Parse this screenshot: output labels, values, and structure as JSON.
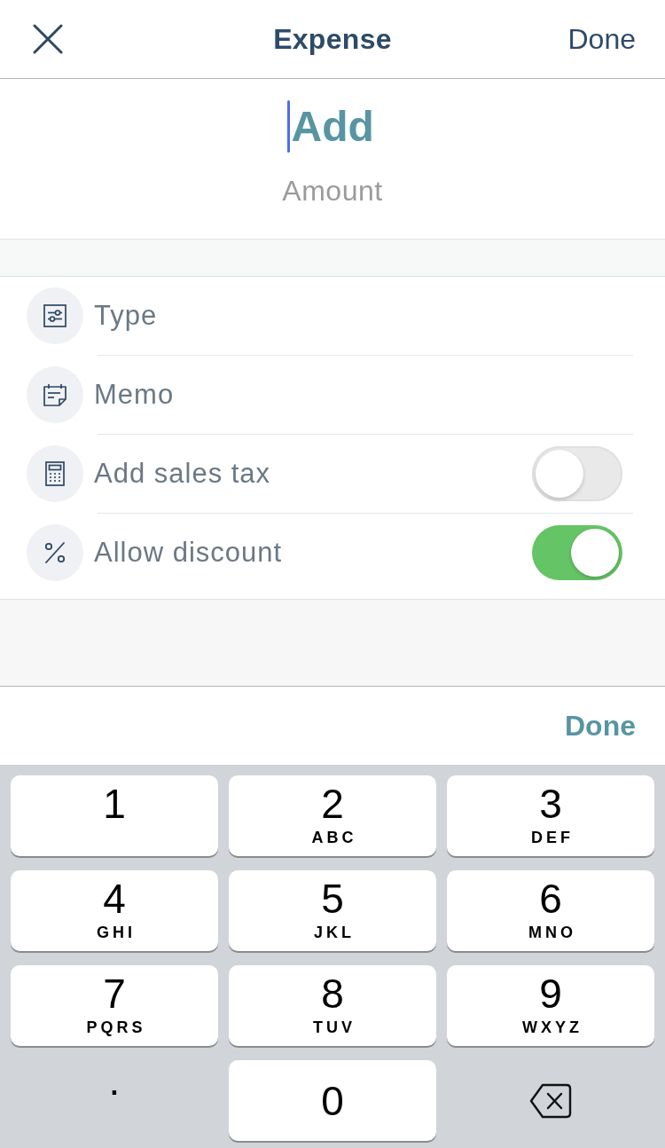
{
  "header": {
    "title": "Expense",
    "done": "Done"
  },
  "amount": {
    "placeholder": "Add",
    "focused": true,
    "label": "Amount"
  },
  "fields": [
    {
      "kind": "picker",
      "label": "Type"
    },
    {
      "kind": "picker",
      "label": "Memo"
    },
    {
      "kind": "toggle",
      "label": "Add sales tax",
      "on": false
    },
    {
      "kind": "toggle",
      "label": "Allow discount",
      "on": true
    }
  ],
  "keyboard_toolbar": {
    "done": "Done"
  },
  "keypad": {
    "keys": [
      {
        "kind": "digit",
        "digit": "1"
      },
      {
        "kind": "digit",
        "digit": "2",
        "letters": "ABC"
      },
      {
        "kind": "digit",
        "digit": "3",
        "letters": "DEF"
      },
      {
        "kind": "digit",
        "digit": "4",
        "letters": "GHI"
      },
      {
        "kind": "digit",
        "digit": "5",
        "letters": "JKL"
      },
      {
        "kind": "digit",
        "digit": "6",
        "letters": "MNO"
      },
      {
        "kind": "digit",
        "digit": "7",
        "letters": "PQRS"
      },
      {
        "kind": "digit",
        "digit": "8",
        "letters": "TUV"
      },
      {
        "kind": "digit",
        "digit": "9",
        "letters": "WXYZ"
      },
      {
        "kind": "decimal",
        "symbol": "."
      },
      {
        "kind": "digit",
        "digit": "0"
      },
      {
        "kind": "delete"
      }
    ]
  }
}
